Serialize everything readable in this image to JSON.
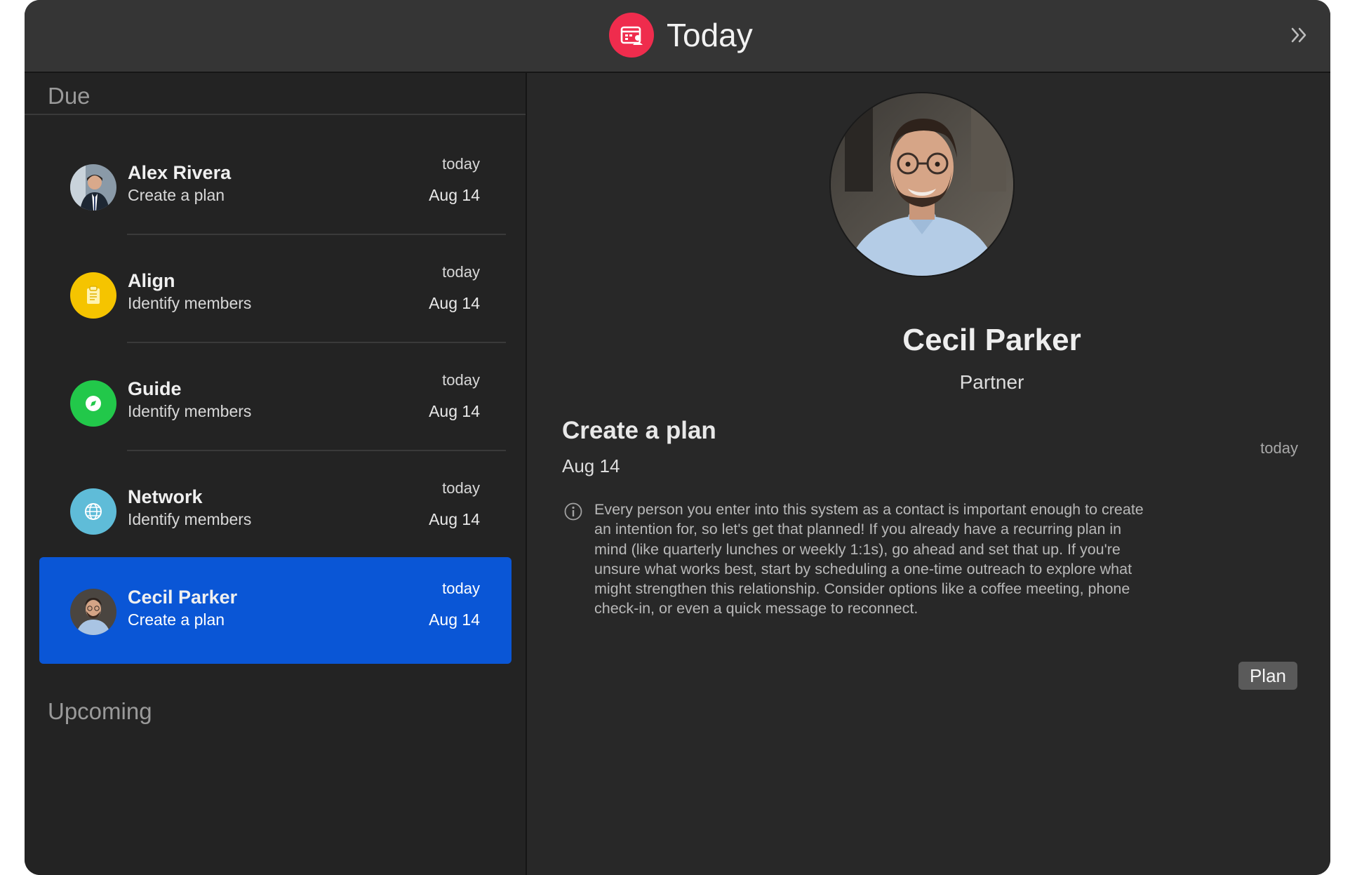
{
  "window": {
    "title": "Today",
    "app_icon": "calendar-person-icon",
    "expand_icon": "double-chevron-right-icon"
  },
  "colors": {
    "accent_red": "#ef2c4d",
    "selection_blue": "#0a56d6",
    "align_yellow": "#f5c400",
    "guide_green": "#22c84a",
    "network_teal": "#5fbcd8"
  },
  "sidebar": {
    "due_header": "Due",
    "upcoming_header": "Upcoming",
    "items": [
      {
        "name": "Alex Rivera",
        "sub": "Create a plan",
        "when": "today",
        "date": "Aug 14",
        "icon": "person-photo"
      },
      {
        "name": "Align",
        "sub": "Identify members",
        "when": "today",
        "date": "Aug 14",
        "icon": "clipboard-icon"
      },
      {
        "name": "Guide",
        "sub": "Identify members",
        "when": "today",
        "date": "Aug 14",
        "icon": "compass-icon"
      },
      {
        "name": "Network",
        "sub": "Identify members",
        "when": "today",
        "date": "Aug 14",
        "icon": "globe-icon"
      },
      {
        "name": "Cecil Parker",
        "sub": "Create a plan",
        "when": "today",
        "date": "Aug 14",
        "icon": "person-photo",
        "selected": true
      }
    ]
  },
  "detail": {
    "name": "Cecil Parker",
    "role": "Partner",
    "task": "Create a plan",
    "date": "Aug 14",
    "when": "today",
    "body": "Every person you enter into this system as a contact is important enough to create an intention for, so let's get that planned! If you already have a recurring plan in mind (like quarterly lunches or weekly 1:1s), go ahead and set that up. If you're unsure what works best, start by scheduling a one-time outreach to explore what might strengthen this relationship. Consider options like a coffee meeting, phone check-in, or even a quick message to reconnect.",
    "plan_button": "Plan"
  }
}
